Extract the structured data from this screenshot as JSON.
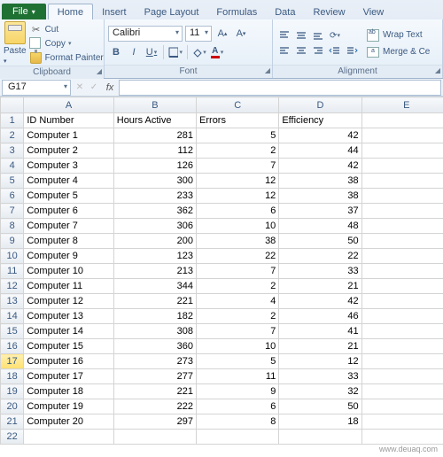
{
  "tabs": {
    "file": "File",
    "home": "Home",
    "insert": "Insert",
    "pagelayout": "Page Layout",
    "formulas": "Formulas",
    "data": "Data",
    "review": "Review",
    "view": "View"
  },
  "clipboard": {
    "paste": "Paste",
    "cut": "Cut",
    "copy": "Copy",
    "format_painter": "Format Painter",
    "group_label": "Clipboard"
  },
  "font": {
    "name": "Calibri",
    "size": "11",
    "grow": "A",
    "shrink": "A",
    "bold": "B",
    "italic": "I",
    "underline": "U",
    "font_color_letter": "A",
    "group_label": "Font"
  },
  "alignment": {
    "wrap": "Wrap Text",
    "merge": "Merge & Ce",
    "group_label": "Alignment"
  },
  "namebox": "G17",
  "formula": "",
  "columns": [
    "A",
    "B",
    "C",
    "D",
    "E"
  ],
  "headers": {
    "A": "ID Number",
    "B": "Hours Active",
    "C": "Errors",
    "D": "Efficiency"
  },
  "rows": [
    {
      "n": 1,
      "A": "ID Number",
      "B": "Hours Active",
      "C": "Errors",
      "D": "Efficiency",
      "header": true
    },
    {
      "n": 2,
      "A": "Computer 1",
      "B": 281,
      "C": 5,
      "D": 42
    },
    {
      "n": 3,
      "A": "Computer 2",
      "B": 112,
      "C": 2,
      "D": 44
    },
    {
      "n": 4,
      "A": "Computer 3",
      "B": 126,
      "C": 7,
      "D": 42
    },
    {
      "n": 5,
      "A": "Computer 4",
      "B": 300,
      "C": 12,
      "D": 38
    },
    {
      "n": 6,
      "A": "Computer 5",
      "B": 233,
      "C": 12,
      "D": 38
    },
    {
      "n": 7,
      "A": "Computer 6",
      "B": 362,
      "C": 6,
      "D": 37
    },
    {
      "n": 8,
      "A": "Computer 7",
      "B": 306,
      "C": 10,
      "D": 48
    },
    {
      "n": 9,
      "A": "Computer 8",
      "B": 200,
      "C": 38,
      "D": 50
    },
    {
      "n": 10,
      "A": "Computer 9",
      "B": 123,
      "C": 22,
      "D": 22
    },
    {
      "n": 11,
      "A": "Computer 10",
      "B": 213,
      "C": 7,
      "D": 33
    },
    {
      "n": 12,
      "A": "Computer 11",
      "B": 344,
      "C": 2,
      "D": 21
    },
    {
      "n": 13,
      "A": "Computer 12",
      "B": 221,
      "C": 4,
      "D": 42
    },
    {
      "n": 14,
      "A": "Computer 13",
      "B": 182,
      "C": 2,
      "D": 46
    },
    {
      "n": 15,
      "A": "Computer 14",
      "B": 308,
      "C": 7,
      "D": 41
    },
    {
      "n": 16,
      "A": "Computer 15",
      "B": 360,
      "C": 10,
      "D": 21
    },
    {
      "n": 17,
      "A": "Computer 16",
      "B": 273,
      "C": 5,
      "D": 12,
      "active": true
    },
    {
      "n": 18,
      "A": "Computer 17",
      "B": 277,
      "C": 11,
      "D": 33
    },
    {
      "n": 19,
      "A": "Computer 18",
      "B": 221,
      "C": 9,
      "D": 32
    },
    {
      "n": 20,
      "A": "Computer 19",
      "B": 222,
      "C": 6,
      "D": 50
    },
    {
      "n": 21,
      "A": "Computer 20",
      "B": 297,
      "C": 8,
      "D": 18
    },
    {
      "n": 22,
      "A": "",
      "B": "",
      "C": "",
      "D": ""
    }
  ],
  "watermark": "www.deuaq.com"
}
